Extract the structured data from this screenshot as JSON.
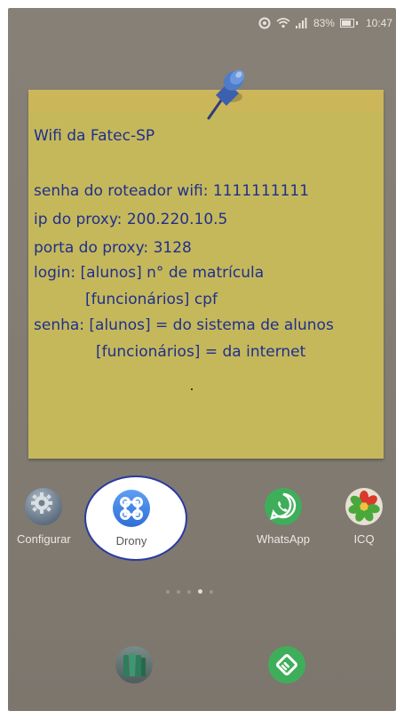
{
  "status_bar": {
    "battery_percent": "83%",
    "battery_level": 0.83,
    "time": "10:47"
  },
  "note": {
    "title": "Wifi da Fatec-SP",
    "lines": [
      "senha do roteador wifi: 1111111111",
      "ip do proxy: 200.220.10.5",
      "porta do proxy: 3128",
      "login: [alunos] n° de matrícula",
      "[funcionários] cpf",
      "senha: [alunos] = do sistema de alunos",
      "[funcionários] = da internet"
    ]
  },
  "apps": {
    "configurar": {
      "label": "Configurar",
      "icon": "gear-icon"
    },
    "drony": {
      "label": "Drony",
      "icon": "command-icon"
    },
    "whatsapp": {
      "label": "WhatsApp",
      "icon": "whatsapp-icon"
    },
    "icq": {
      "label": "ICQ",
      "icon": "flower-icon"
    }
  },
  "dock": [
    {
      "icon": "books-icon"
    },
    {
      "icon": "feedly-icon"
    }
  ],
  "page_indicator": {
    "count": 5,
    "active_index": 3
  },
  "colors": {
    "note_yellow": "#c5b85a",
    "note_text": "#1f2f8e",
    "highlight_border": "#2b3aa0",
    "whatsapp_green": "#3fae5a"
  }
}
